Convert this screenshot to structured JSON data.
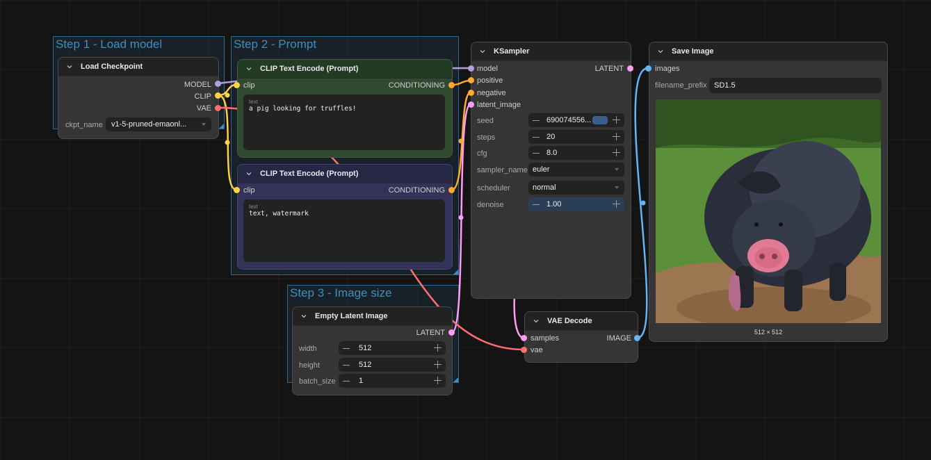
{
  "groups": {
    "load_model": "Step 1 - Load model",
    "prompt": "Step 2 - Prompt",
    "image_size": "Step 3 - Image size"
  },
  "load_checkpoint": {
    "title": "Load Checkpoint",
    "outputs": [
      "MODEL",
      "CLIP",
      "VAE"
    ],
    "ckpt_label": "ckpt_name",
    "ckpt_value": "v1-5-pruned-emaonl..."
  },
  "clip_positive": {
    "title": "CLIP Text Encode (Prompt)",
    "input": "clip",
    "output": "CONDITIONING",
    "text_label": "text",
    "text": "a pig looking for truffles!"
  },
  "clip_negative": {
    "title": "CLIP Text Encode (Prompt)",
    "input": "clip",
    "output": "CONDITIONING",
    "text_label": "text",
    "text": "text, watermark"
  },
  "ksampler": {
    "title": "KSampler",
    "inputs": [
      "model",
      "positive",
      "negative",
      "latent_image"
    ],
    "output": "LATENT",
    "seed_label": "seed",
    "seed_value": "690074556...",
    "steps_label": "steps",
    "steps_value": "20",
    "cfg_label": "cfg",
    "cfg_value": "8.0",
    "sampler_label": "sampler_name",
    "sampler_value": "euler",
    "scheduler_label": "scheduler",
    "scheduler_value": "normal",
    "denoise_label": "denoise",
    "denoise_value": "1.00"
  },
  "empty_latent": {
    "title": "Empty Latent Image",
    "output": "LATENT",
    "width_label": "width",
    "width_value": "512",
    "height_label": "height",
    "height_value": "512",
    "batch_label": "batch_size",
    "batch_value": "1"
  },
  "vae_decode": {
    "title": "VAE Decode",
    "inputs": [
      "samples",
      "vae"
    ],
    "output": "IMAGE"
  },
  "save_image": {
    "title": "Save Image",
    "input": "images",
    "prefix_label": "filename_prefix",
    "prefix_value": "SD1.5",
    "caption": "512 × 512"
  },
  "colors": {
    "model": "#b39ddb",
    "clip": "#ffd23f",
    "vae": "#ff6e6e",
    "conditioning": "#ffa931",
    "latent": "#ff9cf9",
    "image": "#64b5f6"
  }
}
